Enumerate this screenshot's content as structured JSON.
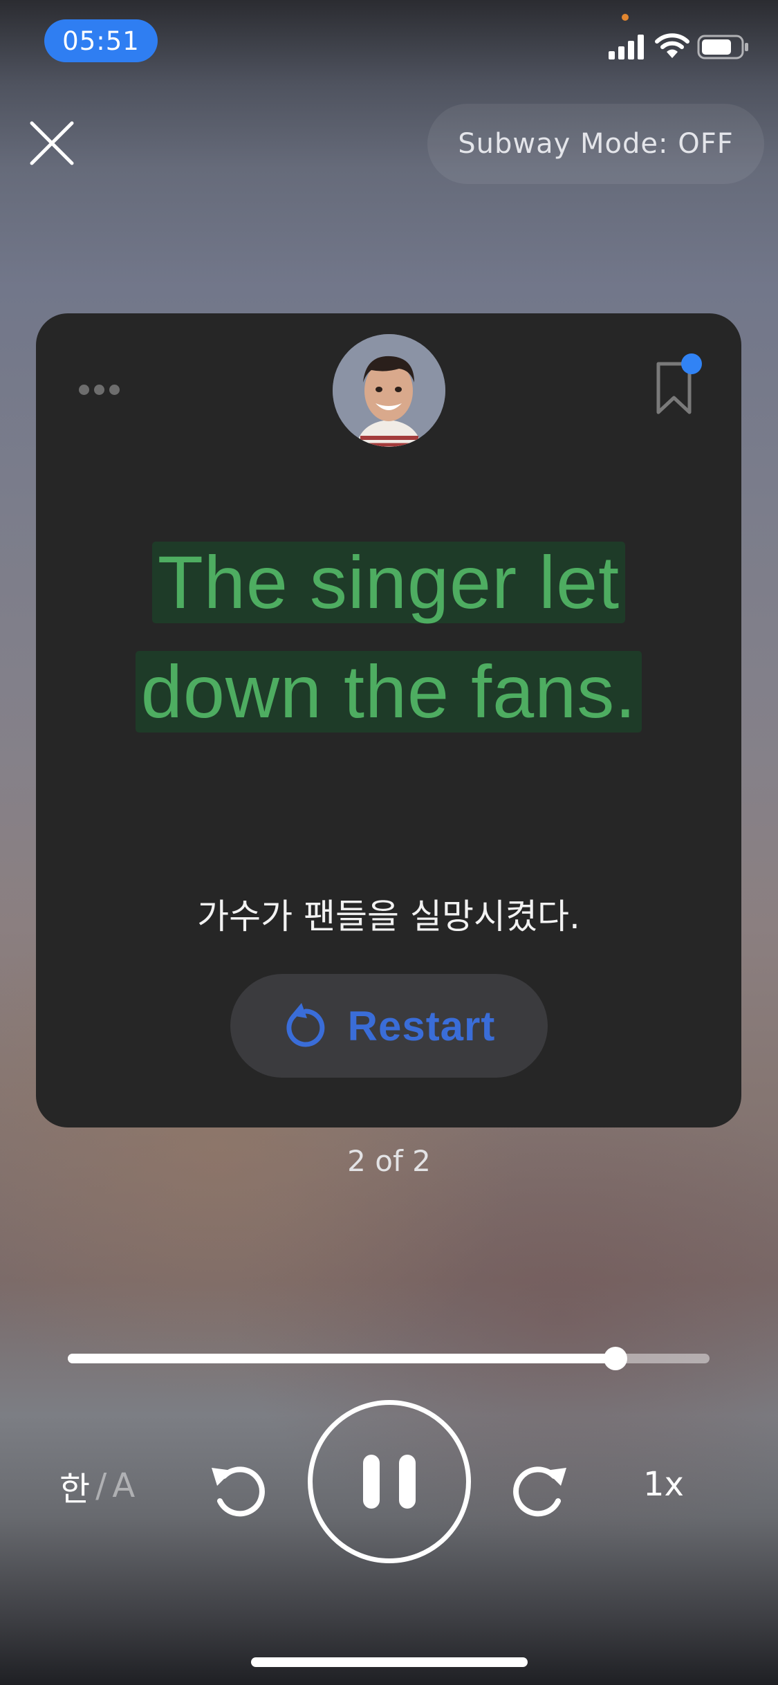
{
  "status_bar": {
    "time": "05:51",
    "icons": [
      "signal-icon",
      "wifi-icon",
      "battery-icon"
    ],
    "time_pill_color": "#2f7ef2"
  },
  "header": {
    "close_icon": "close-icon",
    "subway_mode_label": "Subway Mode: OFF"
  },
  "card": {
    "more_icon": "more-icon",
    "bookmark_icon": "bookmark-icon",
    "bookmark_badge_color": "#3183f5",
    "sentence_lines": [
      "The singer let",
      "down the fans."
    ],
    "sentence_color": "#4ead61",
    "translation": "가수가 팬들을 실망시켰다.",
    "restart_label": "Restart",
    "restart_icon": "restart-icon"
  },
  "pager": {
    "label": "2 of 2"
  },
  "player": {
    "progress_fraction": 0.853,
    "language_primary": "한",
    "language_separator": "/",
    "language_secondary": "A",
    "rewind_icon": "rewind-icon",
    "pause_icon": "pause-icon",
    "forward_icon": "forward-icon",
    "speed_label": "1x"
  }
}
